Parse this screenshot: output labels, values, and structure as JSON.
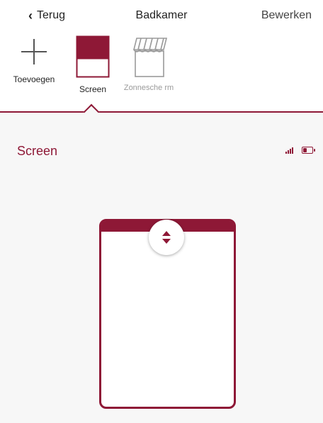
{
  "nav": {
    "back_label": "Terug",
    "title": "Badkamer",
    "edit_label": "Bewerken"
  },
  "devices": [
    {
      "label": "Toevoegen",
      "icon": "plus-icon"
    },
    {
      "label": "Screen",
      "icon": "screen-icon",
      "selected": true
    },
    {
      "label": "Zonnesche rm",
      "icon": "awning-icon",
      "disabled": true
    }
  ],
  "panel": {
    "title": "Screen",
    "signal_icon": "signal-icon",
    "battery_icon": "battery-icon",
    "battery_level": 0.4
  },
  "colors": {
    "accent": "#8e1836",
    "panel_bg": "#f7f7f7"
  }
}
